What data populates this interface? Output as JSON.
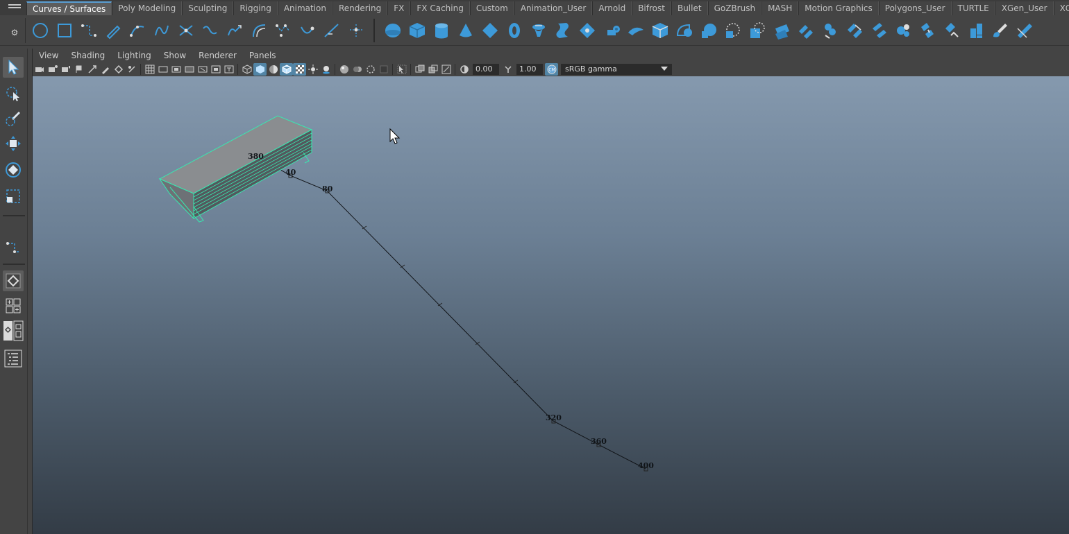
{
  "shelf": {
    "tabs": [
      "Curves / Surfaces",
      "Poly Modeling",
      "Sculpting",
      "Rigging",
      "Animation",
      "Rendering",
      "FX",
      "FX Caching",
      "Custom",
      "Animation_User",
      "Arnold",
      "Bifrost",
      "Bullet",
      "GoZBrush",
      "MASH",
      "Motion Graphics",
      "Polygons_User",
      "TURTLE",
      "XGen_User",
      "XGen"
    ],
    "active_tab": "Curves / Surfaces"
  },
  "panel": {
    "menu": [
      "View",
      "Shading",
      "Lighting",
      "Show",
      "Renderer",
      "Panels"
    ],
    "near_value": "0.00",
    "far_value": "1.00",
    "color_space": "sRGB gamma"
  },
  "motion_path": {
    "frame_labels": [
      "380",
      "40",
      "80",
      "320",
      "360",
      "400"
    ]
  },
  "colors": {
    "accent": "#5a9fd4",
    "selection": "#38e8b0",
    "icon_blue": "#3d9ad9"
  }
}
